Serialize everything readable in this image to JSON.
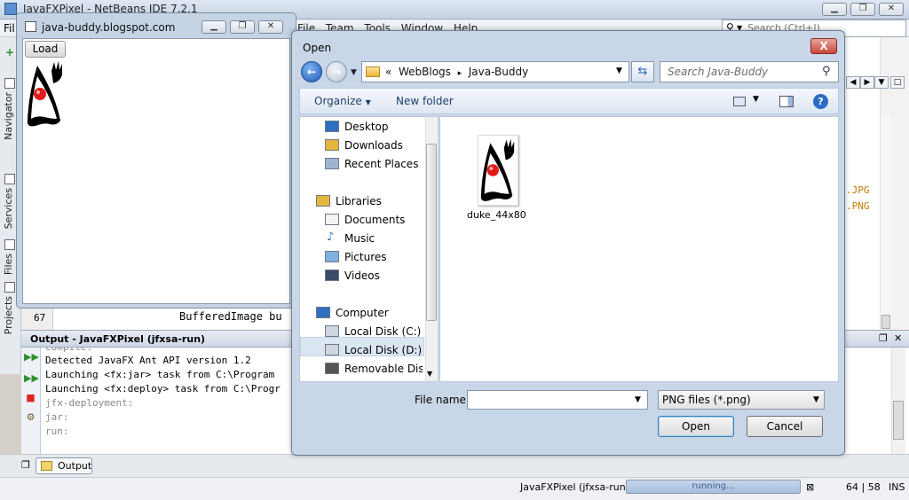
{
  "ide": {
    "title": "JavaFXPixel - NetBeans IDE 7.2.1",
    "menu_file": "Fil",
    "menu_rest": "File Team Tools Window Help",
    "search_placeholder": "Search (Ctrl+I)",
    "side_tabs": [
      "Navigator",
      "Services",
      "Files",
      "Projects"
    ],
    "editor": {
      "line_number": "67",
      "code": "BufferedImage bu",
      "ext1": ".JPG",
      "ext2": ".PNG"
    },
    "output": {
      "title": "Output - JavaFXPixel (jfxsa-run)",
      "lines": [
        "Detected JavaFX Ant API version 1.2",
        "Launching <fx:jar> task from C:\\Program",
        "Launching <fx:deploy> task from C:\\Progr",
        "jfx-deployment:",
        "jar:",
        "run:"
      ],
      "partial_line": "Compile:"
    },
    "bottom_tab": "Output",
    "status": {
      "project": "JavaFXPixel (jfxsa-run)",
      "progress_text": "running...",
      "position": "64 | 58",
      "mode": "INS"
    }
  },
  "fx_app": {
    "title": "java-buddy.blogspot.com",
    "load_button": "Load"
  },
  "dialog": {
    "title": "Open",
    "close": "X",
    "address": {
      "prefix": "«",
      "parts": [
        "WebBlogs",
        "Java-Buddy"
      ],
      "sep": "▸"
    },
    "search_placeholder": "Search Java-Buddy",
    "toolbar": {
      "organize": "Organize",
      "new_folder": "New folder",
      "help": "?"
    },
    "nav": {
      "favorites": [
        "Desktop",
        "Downloads",
        "Recent Places"
      ],
      "libraries_label": "Libraries",
      "libraries": [
        "Documents",
        "Music",
        "Pictures",
        "Videos"
      ],
      "computer_label": "Computer",
      "drives": [
        "Local Disk (C:)",
        "Local Disk (D:)",
        "Removable Disk ("
      ]
    },
    "files": [
      {
        "name": "duke_44x80"
      }
    ],
    "file_name_label": "File name:",
    "file_name_value": "",
    "file_type": "PNG files (*.png)",
    "open_button": "Open",
    "cancel_button": "Cancel"
  }
}
